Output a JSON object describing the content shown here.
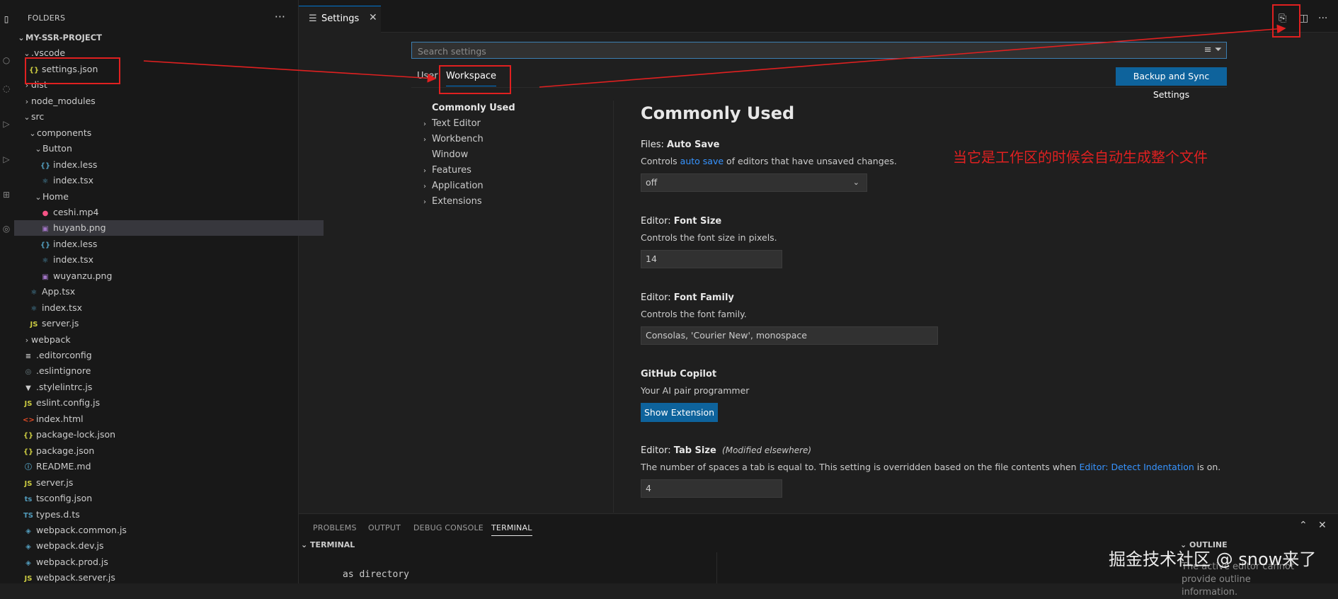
{
  "sidebar": {
    "header": "FOLDERS",
    "more_icon": "ellipsis-icon",
    "tree": [
      {
        "label": "MY-SSR-PROJECT",
        "type": "root",
        "open": true,
        "indent": 0
      },
      {
        "label": ".vscode",
        "type": "folder",
        "open": true,
        "indent": 1
      },
      {
        "label": "settings.json",
        "type": "json",
        "indent": 2
      },
      {
        "label": "dist",
        "type": "folder",
        "open": false,
        "indent": 1
      },
      {
        "label": "node_modules",
        "type": "folder",
        "open": false,
        "indent": 1
      },
      {
        "label": "src",
        "type": "folder",
        "open": true,
        "indent": 1
      },
      {
        "label": "components",
        "type": "folder",
        "open": true,
        "indent": 2
      },
      {
        "label": "Button",
        "type": "folder",
        "open": true,
        "indent": 3
      },
      {
        "label": "index.less",
        "type": "less",
        "indent": 4
      },
      {
        "label": "index.tsx",
        "type": "tsx",
        "indent": 4
      },
      {
        "label": "Home",
        "type": "folder",
        "open": true,
        "indent": 3
      },
      {
        "label": "ceshi.mp4",
        "type": "video",
        "indent": 4
      },
      {
        "label": "huyanb.png",
        "type": "image",
        "indent": 4,
        "selected": true
      },
      {
        "label": "index.less",
        "type": "less",
        "indent": 4
      },
      {
        "label": "index.tsx",
        "type": "tsx",
        "indent": 4
      },
      {
        "label": "wuyanzu.png",
        "type": "image",
        "indent": 4
      },
      {
        "label": "App.tsx",
        "type": "tsx",
        "indent": 2
      },
      {
        "label": "index.tsx",
        "type": "tsx",
        "indent": 2
      },
      {
        "label": "server.js",
        "type": "js",
        "indent": 2
      },
      {
        "label": "webpack",
        "type": "folder",
        "open": false,
        "indent": 1
      },
      {
        "label": ".editorconfig",
        "type": "config",
        "indent": 1
      },
      {
        "label": ".eslintignore",
        "type": "ignore",
        "indent": 1
      },
      {
        "label": ".stylelintrc.js",
        "type": "stylelint",
        "indent": 1
      },
      {
        "label": "eslint.config.js",
        "type": "js",
        "indent": 1
      },
      {
        "label": "index.html",
        "type": "html",
        "indent": 1
      },
      {
        "label": "package-lock.json",
        "type": "json",
        "indent": 1
      },
      {
        "label": "package.json",
        "type": "json",
        "indent": 1
      },
      {
        "label": "README.md",
        "type": "info",
        "indent": 1
      },
      {
        "label": "server.js",
        "type": "js",
        "indent": 1
      },
      {
        "label": "tsconfig.json",
        "type": "tsconfig",
        "indent": 1
      },
      {
        "label": "types.d.ts",
        "type": "ts",
        "indent": 1
      },
      {
        "label": "webpack.common.js",
        "type": "webpack",
        "indent": 1
      },
      {
        "label": "webpack.dev.js",
        "type": "webpack",
        "indent": 1
      },
      {
        "label": "webpack.prod.js",
        "type": "webpack",
        "indent": 1
      },
      {
        "label": "webpack.server.js",
        "type": "js",
        "indent": 1
      }
    ]
  },
  "editor": {
    "tab": {
      "label": "Settings",
      "icon": "settings-icon"
    },
    "top_icons": [
      "open-settings-json-icon",
      "split-editor-icon",
      "more-actions-icon"
    ]
  },
  "settings": {
    "search_placeholder": "Search settings",
    "scopes": {
      "user": "User",
      "workspace": "Workspace"
    },
    "sync_button": "Backup and Sync Settings",
    "toc": [
      {
        "label": "Commonly Used",
        "bold": true,
        "chevron": false
      },
      {
        "label": "Text Editor",
        "chevron": true
      },
      {
        "label": "Workbench",
        "chevron": true
      },
      {
        "label": "Window",
        "chevron": false
      },
      {
        "label": "Features",
        "chevron": true
      },
      {
        "label": "Application",
        "chevron": true
      },
      {
        "label": "Extensions",
        "chevron": true
      }
    ],
    "section_title": "Commonly Used",
    "items": {
      "auto_save": {
        "category": "Files: ",
        "name": "Auto Save",
        "desc_before": "Controls ",
        "desc_link": "auto save",
        "desc_after": " of editors that have unsaved changes.",
        "value": "off"
      },
      "font_size": {
        "category": "Editor: ",
        "name": "Font Size",
        "desc": "Controls the font size in pixels.",
        "value": "14"
      },
      "font_family": {
        "category": "Editor: ",
        "name": "Font Family",
        "desc": "Controls the font family.",
        "value": "Consolas, 'Courier New', monospace"
      },
      "copilot": {
        "name": "GitHub Copilot",
        "desc": "Your AI pair programmer",
        "button": "Show Extension"
      },
      "tab_size": {
        "category": "Editor: ",
        "name": "Tab Size",
        "modified": "(Modified elsewhere)",
        "desc_before": "The number of spaces a tab is equal to. This setting is overridden based on the file contents when ",
        "desc_link": "Editor: Detect Indentation",
        "desc_after": " is on.",
        "value": "4"
      }
    }
  },
  "annotation": {
    "text": "当它是工作区的时候会自动生成整个文件",
    "color": "#e02020"
  },
  "panel": {
    "tabs": [
      "PROBLEMS",
      "OUTPUT",
      "DEBUG CONSOLE",
      "TERMINAL"
    ],
    "active_tab": "TERMINAL",
    "terminal_header": "TERMINAL",
    "terminal_text": "as directory",
    "outline_header": "OUTLINE",
    "outline_message": "The active editor cannot provide outline information."
  },
  "watermark": "掘金技术社区 @ snow来了",
  "colors": {
    "accent": "#0078d4",
    "button": "#0e639c",
    "link": "#3794ff",
    "annotation": "#e02020"
  }
}
